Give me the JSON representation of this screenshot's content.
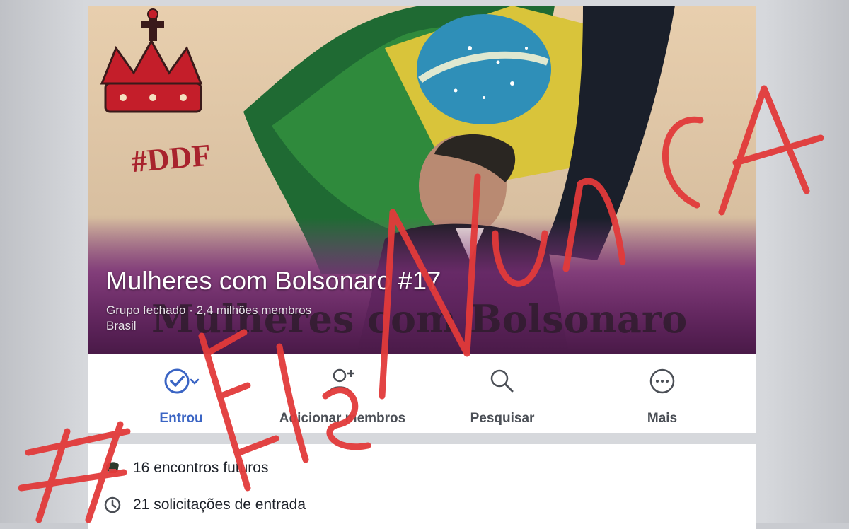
{
  "cover": {
    "logo_text": "#DDF",
    "banner_text": "Mulheres com Bolsonaro",
    "title": "Mulheres com Bolsonaro #17",
    "group_info": "Grupo fechado · 2,4 milhões membros",
    "location": "Brasil"
  },
  "actions": [
    {
      "label": "Entrou",
      "icon": "check-circle-icon",
      "active": true
    },
    {
      "label": "Adicionar membros",
      "icon": "add-user-icon",
      "active": false
    },
    {
      "label": "Pesquisar",
      "icon": "search-icon",
      "active": false
    },
    {
      "label": "Mais",
      "icon": "more-icon",
      "active": false
    }
  ],
  "info": [
    {
      "text": "16 encontros futuros",
      "icon": "events-icon"
    },
    {
      "text": "21 solicitações de entrada",
      "icon": "clock-icon"
    }
  ],
  "overlay_scrawl": "#EleNunca",
  "colors": {
    "accent": "#3b65c4",
    "scrawl": "#e23a3a",
    "banner_purple": "#7a2d78"
  }
}
